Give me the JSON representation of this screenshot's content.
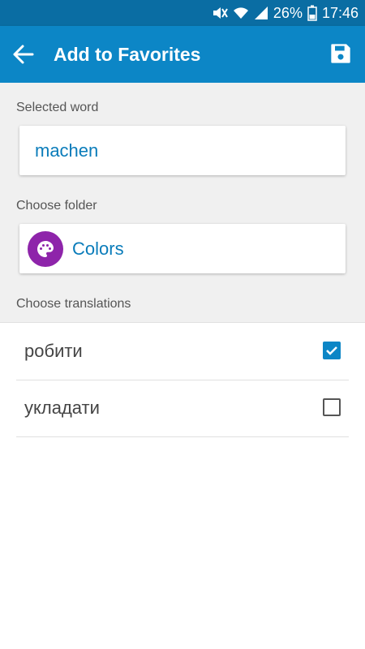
{
  "status_bar": {
    "battery": "26%",
    "time": "17:46"
  },
  "app_bar": {
    "title": "Add to Favorites"
  },
  "selected_word": {
    "label": "Selected word",
    "value": "machen"
  },
  "folder": {
    "label": "Choose folder",
    "name": "Colors",
    "icon": "palette-icon",
    "icon_color": "#8e24aa"
  },
  "translations": {
    "label": "Choose translations",
    "items": [
      {
        "text": "робити",
        "checked": true
      },
      {
        "text": "укладати",
        "checked": false
      }
    ]
  },
  "colors": {
    "accent": "#0c86c6",
    "status_bar": "#0a6da3",
    "link_text": "#0a7cba"
  }
}
